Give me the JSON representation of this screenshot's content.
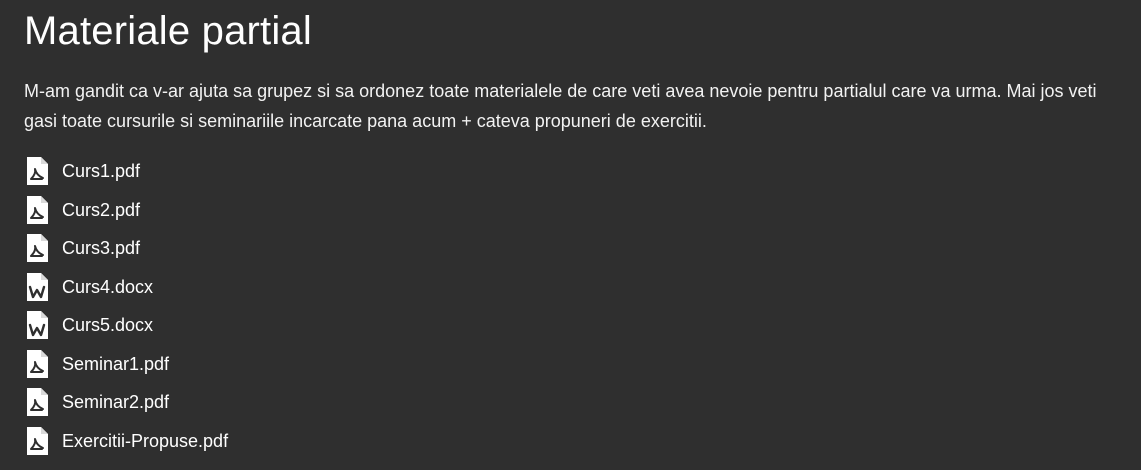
{
  "page": {
    "title": "Materiale partial",
    "description": "M-am gandit ca v-ar ajuta sa grupez si sa ordonez toate materialele de care veti avea nevoie pentru partialul care va urma. Mai jos veti gasi toate cursurile si seminariile incarcate pana acum + cateva propuneri de exercitii."
  },
  "files": [
    {
      "name": "Curs1.pdf",
      "icon": "pdf-file-icon"
    },
    {
      "name": "Curs2.pdf",
      "icon": "pdf-file-icon"
    },
    {
      "name": "Curs3.pdf",
      "icon": "pdf-file-icon"
    },
    {
      "name": "Curs4.docx",
      "icon": "word-file-icon"
    },
    {
      "name": "Curs5.docx",
      "icon": "word-file-icon"
    },
    {
      "name": "Seminar1.pdf",
      "icon": "pdf-file-icon"
    },
    {
      "name": "Seminar2.pdf",
      "icon": "pdf-file-icon"
    },
    {
      "name": "Exercitii-Propuse.pdf",
      "icon": "pdf-file-icon"
    }
  ],
  "colors": {
    "background": "#2f2f2f",
    "text": "#ffffff",
    "icon_fill": "#ffffff",
    "icon_mark": "#2f2f2f"
  }
}
